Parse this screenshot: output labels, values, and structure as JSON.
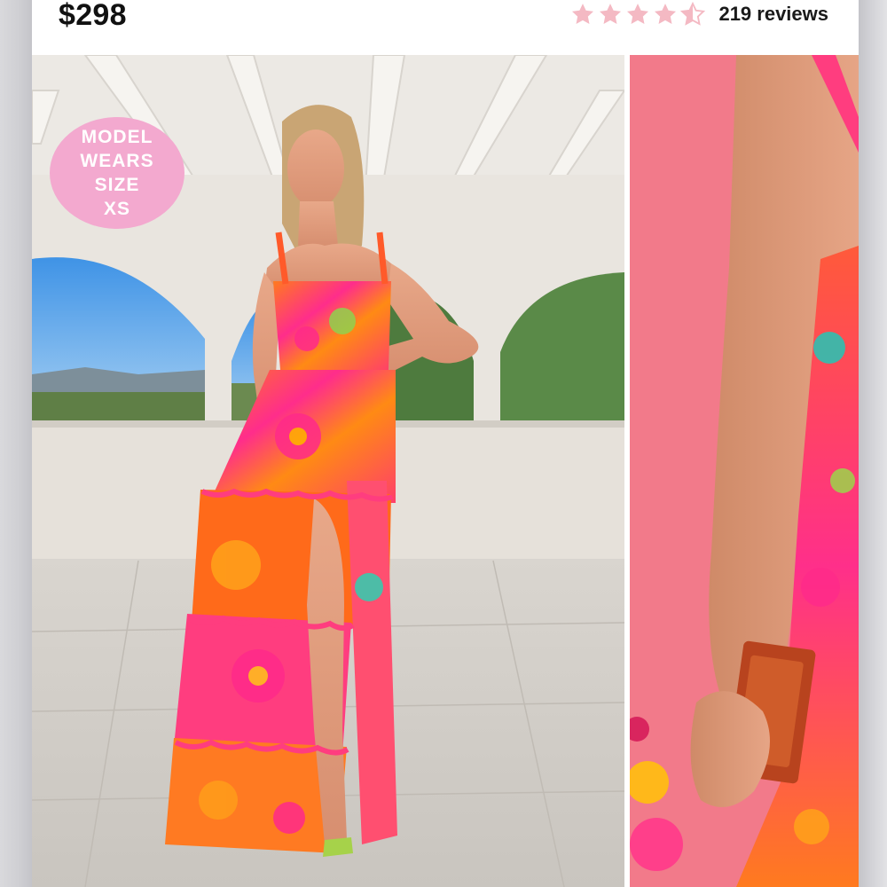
{
  "product": {
    "price": "$298",
    "rating_value": 4.5,
    "rating_max": 5,
    "reviews_label": "219 reviews"
  },
  "gallery": {
    "size_badge": {
      "line1": "MODEL",
      "line2": "WEARS",
      "line3": "SIZE",
      "line4": "XS"
    }
  },
  "colors": {
    "star": "#f4b9c3",
    "badge": "#f3a9cf",
    "side_background": "#f27a8a",
    "dress_orange": "#ff6a1a",
    "dress_pink": "#ff2f8a"
  },
  "icons": [
    "star-icon",
    "half-star-icon"
  ]
}
